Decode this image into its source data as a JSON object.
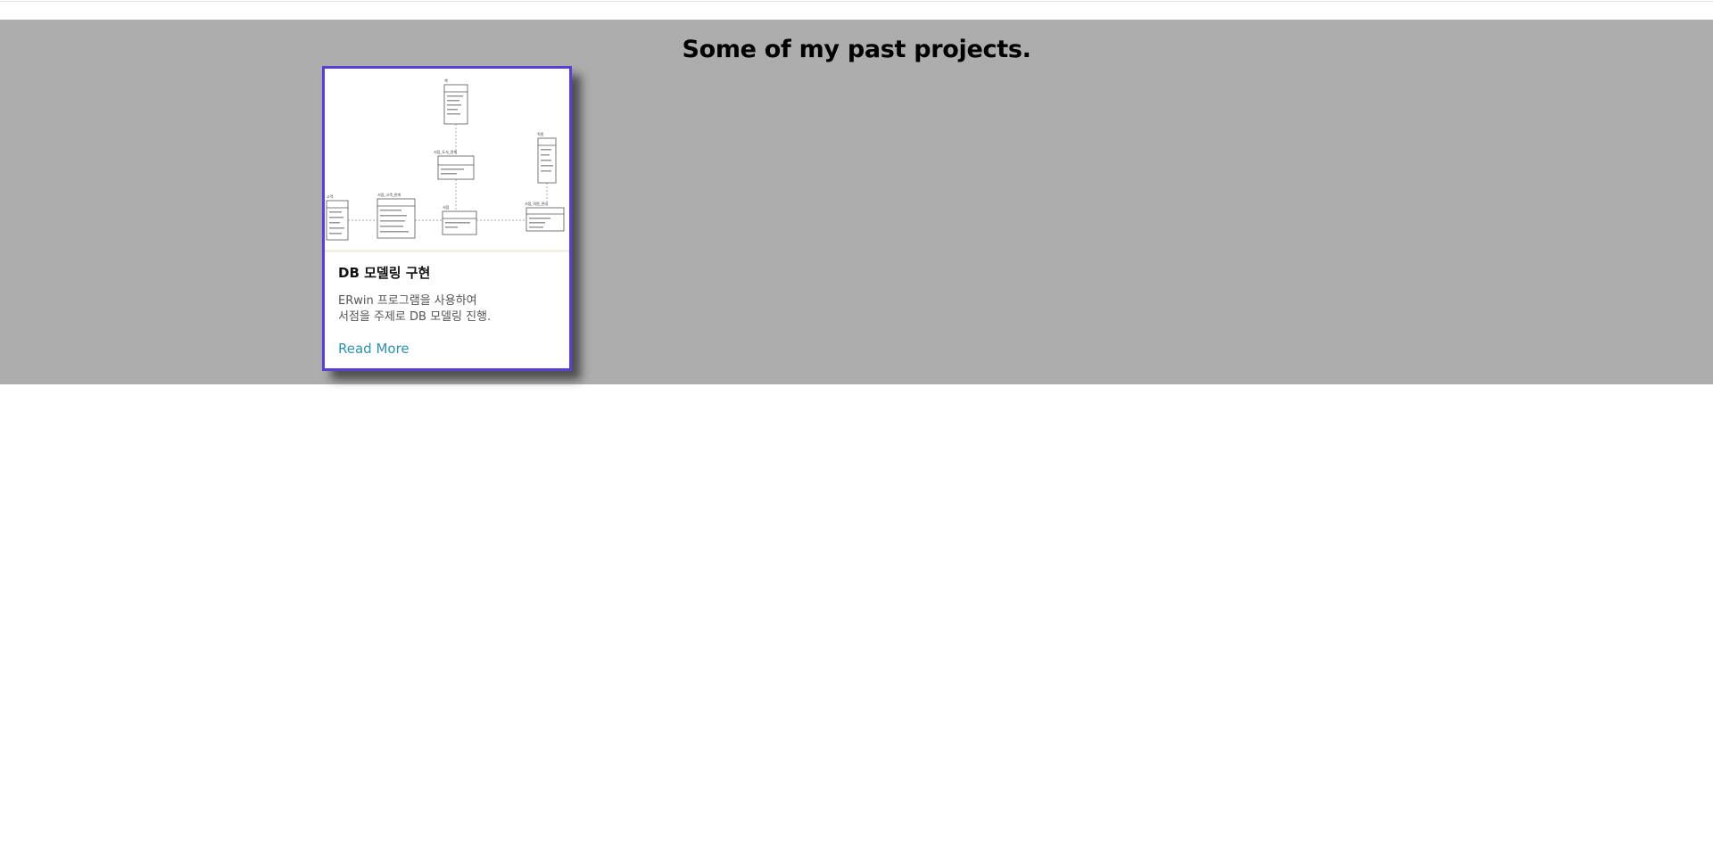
{
  "section": {
    "title": "Some of my past projects."
  },
  "projects": [
    {
      "title": "DB 모델링 구현",
      "description_lines": [
        "ERwin 프로그램을 사용하여",
        "서점을 주제로 DB 모델링 진행."
      ],
      "link_label": "Read More",
      "image_icon": "er-diagram-thumbnail"
    }
  ],
  "colors": {
    "section_background": "#adadad",
    "card_border": "#5a3fd6",
    "link": "#2a93b6"
  }
}
